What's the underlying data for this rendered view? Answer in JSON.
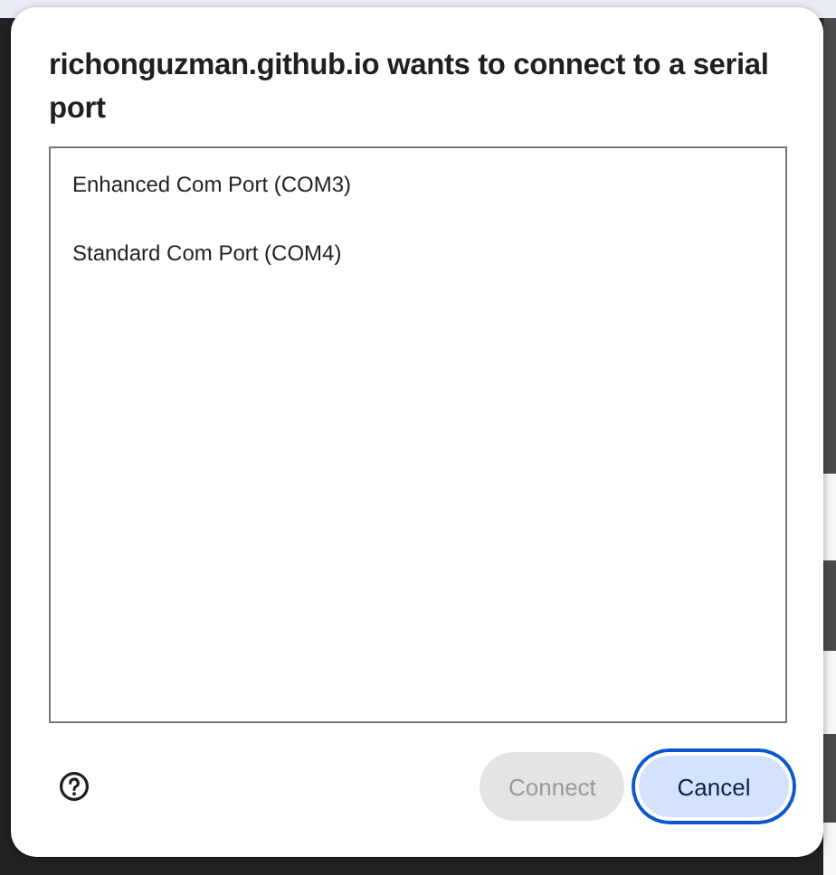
{
  "dialog": {
    "title": "richonguzman.github.io wants to connect to a serial port",
    "ports": [
      {
        "label": "Enhanced Com Port (COM3)",
        "selected": false
      },
      {
        "label": "Standard Com Port (COM4)",
        "selected": false
      }
    ],
    "buttons": [
      {
        "label": "Connect",
        "disabled": true,
        "focused": false
      },
      {
        "label": "Cancel",
        "disabled": false,
        "focused": true
      }
    ]
  }
}
